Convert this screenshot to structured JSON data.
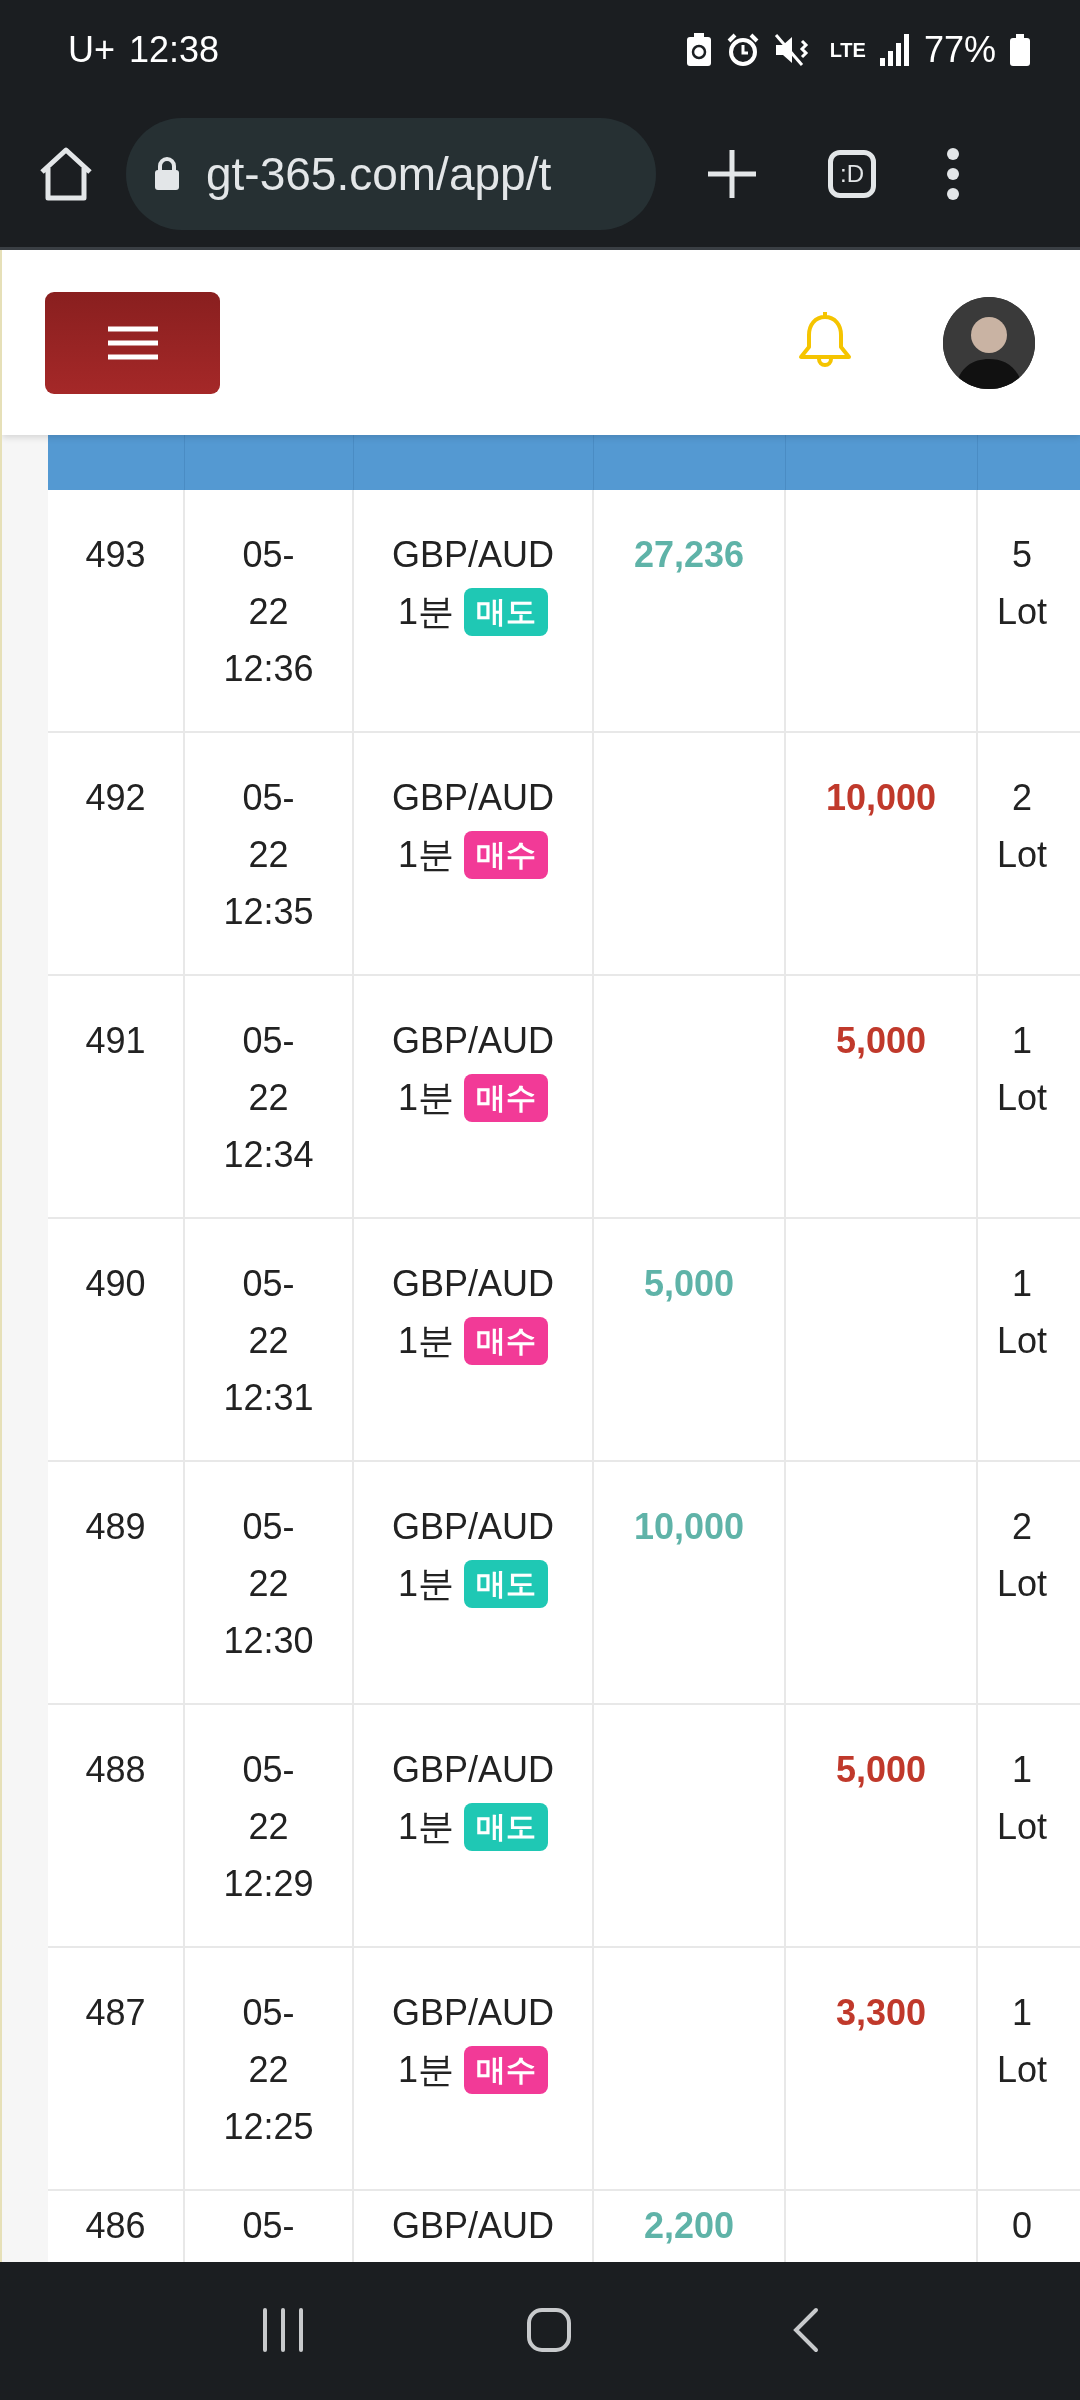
{
  "status_bar": {
    "carrier": "U+",
    "time": "12:38",
    "network": "LTE",
    "battery": "77%"
  },
  "browser": {
    "url": "gt-365.com/app/t",
    "tab_button": ":D"
  },
  "table": {
    "rows": [
      {
        "no": "493",
        "date_lines": [
          "05-",
          "22",
          "12:36"
        ],
        "pair": "GBP/AUD",
        "period": "1분",
        "badge": {
          "label": "매도",
          "color": "#1fc8b4"
        },
        "column_4": "27,236",
        "lot": "5 Lot"
      },
      {
        "no": "492",
        "date_lines": [
          "05-",
          "22",
          "12:35"
        ],
        "pair": "GBP/AUD",
        "period": "1분",
        "badge": {
          "label": "매수",
          "color": "#f23a97"
        },
        "column_5": "10,000",
        "lot": "2 Lot"
      },
      {
        "no": "491",
        "date_lines": [
          "05-",
          "22",
          "12:34"
        ],
        "pair": "GBP/AUD",
        "period": "1분",
        "badge": {
          "label": "매수",
          "color": "#f23a97"
        },
        "column_5": "5,000",
        "lot": "1 Lot"
      },
      {
        "no": "490",
        "date_lines": [
          "05-",
          "22",
          "12:31"
        ],
        "pair": "GBP/AUD",
        "period": "1분",
        "badge": {
          "label": "매수",
          "color": "#f23a97"
        },
        "column_4": "5,000",
        "lot": "1 Lot"
      },
      {
        "no": "489",
        "date_lines": [
          "05-",
          "22",
          "12:30"
        ],
        "pair": "GBP/AUD",
        "period": "1분",
        "badge": {
          "label": "매도",
          "color": "#1fc8b4"
        },
        "column_4": "10,000",
        "lot": "2 Lot"
      },
      {
        "no": "488",
        "date_lines": [
          "05-",
          "22",
          "12:29"
        ],
        "pair": "GBP/AUD",
        "period": "1분",
        "badge": {
          "label": "매도",
          "color": "#1fc8b4"
        },
        "column_5": "5,000",
        "lot": "1 Lot"
      },
      {
        "no": "487",
        "date_lines": [
          "05-",
          "22",
          "12:25"
        ],
        "pair": "GBP/AUD",
        "period": "1분",
        "badge": {
          "label": "매수",
          "color": "#f23a97"
        },
        "column_5": "3,300",
        "lot": "1 Lot"
      },
      {
        "no": "486",
        "date_lines": [
          "05-"
        ],
        "pair": "GBP/AUD",
        "column_4": "2,200",
        "lot": "0"
      }
    ]
  }
}
